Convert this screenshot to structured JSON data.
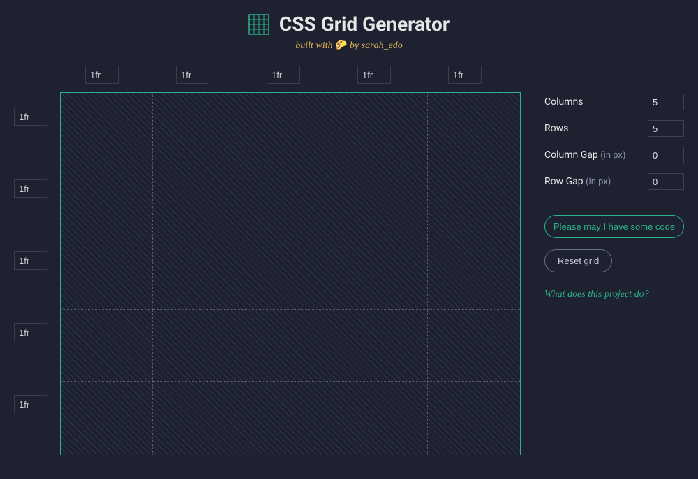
{
  "header": {
    "title": "CSS Grid Generator",
    "subtitle_prefix": "built with ",
    "subtitle_emoji": "🌮",
    "subtitle_by": " by sarah_edo"
  },
  "column_sizes": [
    "1fr",
    "1fr",
    "1fr",
    "1fr",
    "1fr"
  ],
  "row_sizes": [
    "1fr",
    "1fr",
    "1fr",
    "1fr",
    "1fr"
  ],
  "sidebar": {
    "columns_label": "Columns",
    "columns_value": "5",
    "rows_label": "Rows",
    "rows_value": "5",
    "colgap_label": "Column Gap",
    "colgap_units": "(in px)",
    "colgap_value": "0",
    "rowgap_label": "Row Gap",
    "rowgap_units": "(in px)",
    "rowgap_value": "0",
    "code_button": "Please may I have some code",
    "reset_button": "Reset grid",
    "about_link": "What does this project do?"
  }
}
